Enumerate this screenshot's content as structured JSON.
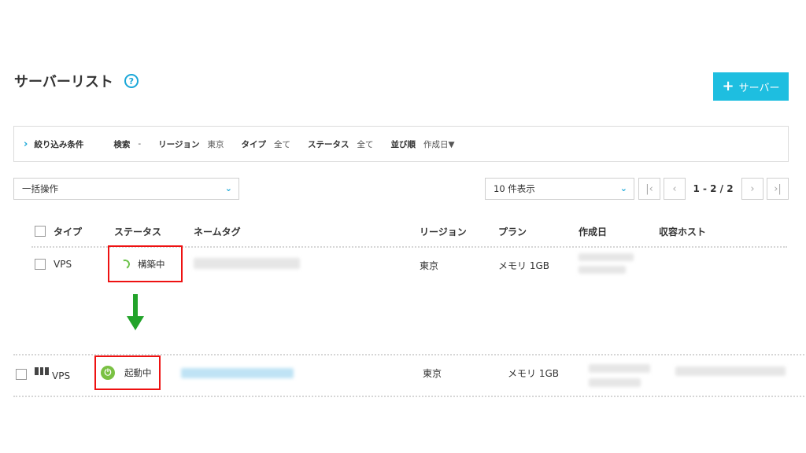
{
  "page": {
    "title": "サーバーリスト",
    "help_glyph": "?"
  },
  "header": {
    "add_server_label": "サーバー",
    "add_server_plus": "+"
  },
  "filter": {
    "title": "絞り込み条件",
    "chevron": "›",
    "items": [
      {
        "label": "検索",
        "value": "-"
      },
      {
        "label": "リージョン",
        "value": "東京"
      },
      {
        "label": "タイプ",
        "value": "全て"
      },
      {
        "label": "ステータス",
        "value": "全て"
      },
      {
        "label": "並び順",
        "value": "作成日▼"
      }
    ]
  },
  "controls": {
    "bulk_action": "一括操作",
    "per_page": "10 件表示",
    "pagination": "1 - 2 / 2",
    "first_glyph": "|‹",
    "prev_glyph": "‹",
    "next_glyph": "›",
    "last_glyph": "›|",
    "caret_glyph": "⌄"
  },
  "table": {
    "headers": {
      "type": "タイプ",
      "status": "ステータス",
      "nametag": "ネームタグ",
      "region": "リージョン",
      "plan": "プラン",
      "created": "作成日",
      "host": "収容ホスト"
    },
    "rows": [
      {
        "type": "VPS",
        "status": "構築中",
        "region": "東京",
        "plan": "メモリ 1GB"
      },
      {
        "type": "VPS",
        "status": "起動中",
        "region": "東京",
        "plan": "メモリ 1GB"
      }
    ]
  },
  "icons": {
    "help": "help-icon",
    "spinner": "loading-spinner-icon",
    "power": "power-icon",
    "server": "server-icon",
    "arrow": "arrow-down-icon"
  },
  "colors": {
    "accent": "#1ebee0",
    "highlight": "#e11111",
    "arrow": "#22a32a",
    "running": "#7ac143"
  }
}
